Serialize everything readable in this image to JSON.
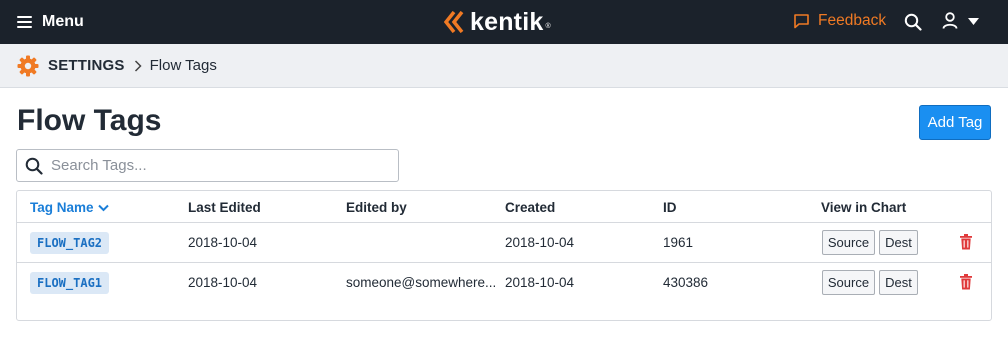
{
  "topbar": {
    "menu_label": "Menu",
    "logo_text": "kentik",
    "logo_reg": "®",
    "feedback_label": "Feedback",
    "accent_color": "#f07a24"
  },
  "breadcrumb": {
    "section": "SETTINGS",
    "current": "Flow Tags"
  },
  "page": {
    "title": "Flow Tags",
    "add_button": "Add Tag"
  },
  "search": {
    "placeholder": "Search Tags...",
    "value": ""
  },
  "table": {
    "columns": [
      "Tag Name",
      "Last Edited",
      "Edited by",
      "Created",
      "ID",
      "View in Chart"
    ],
    "sort_column": "Tag Name",
    "rows": [
      {
        "tag": "FLOW_TAG2",
        "last_edited": "2018-10-04",
        "edited_by": "",
        "created": "2018-10-04",
        "id": "1961",
        "source_label": "Source",
        "dest_label": "Dest"
      },
      {
        "tag": "FLOW_TAG1",
        "last_edited": "2018-10-04",
        "edited_by": "someone@somewhere...",
        "created": "2018-10-04",
        "id": "430386",
        "source_label": "Source",
        "dest_label": "Dest"
      }
    ]
  },
  "icons": {
    "menu": "hamburger-icon",
    "logo": "kentik-logo-icon",
    "feedback": "speech-bubble-icon",
    "search": "search-icon",
    "user": "user-icon",
    "caret": "caret-down-icon",
    "settings": "gear-icon",
    "sort": "chevron-down-icon",
    "delete": "trash-icon"
  },
  "colors": {
    "brand_orange": "#f07a24",
    "primary_blue": "#1a8ff1",
    "delete_red": "#e0393b",
    "topbar_bg": "#1b222b"
  }
}
